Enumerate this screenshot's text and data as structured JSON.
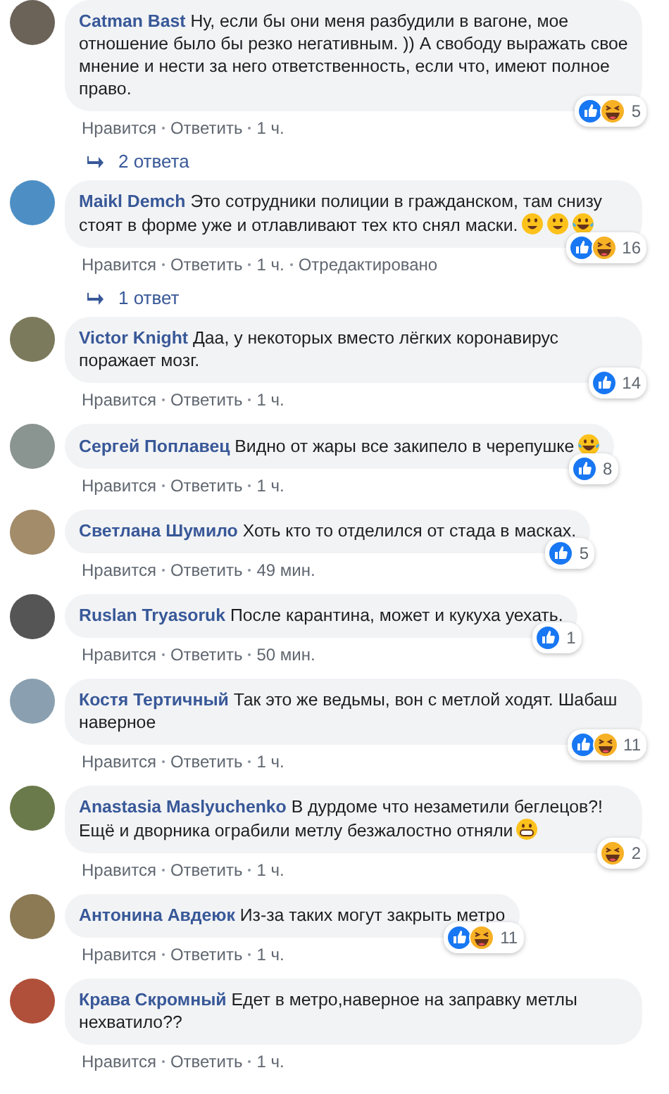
{
  "comments": [
    {
      "author": "Catman Bast",
      "text": "Ну, если бы они меня разбудили в вагоне, мое отношение было бы резко негативным. )) А свободу выражать свое мнение и нести за него ответственность, если что, имеют полное право.",
      "reactions": [
        {
          "kind": "like"
        },
        {
          "kind": "haha"
        }
      ],
      "reaction_count": "5",
      "actions": [
        "Нравится",
        "Ответить",
        "1 ч."
      ],
      "replies": "2 ответа"
    },
    {
      "author": "Maikl Demch",
      "text": "Это сотрудники полиции в гражданском, там снизу стоят в форме уже и отлавливают тех кто снял маски.",
      "emojis": [
        {
          "kind": "smile"
        },
        {
          "kind": "smile"
        },
        {
          "kind": "joy"
        }
      ],
      "reactions": [
        {
          "kind": "like"
        },
        {
          "kind": "haha"
        }
      ],
      "reaction_count": "16",
      "actions": [
        "Нравится",
        "Ответить",
        "1 ч.",
        "Отредактировано"
      ],
      "replies": "1 ответ"
    },
    {
      "author": "Victor Knight",
      "text": "Даа, у некоторых вместо лёгких коронавирус поражает мозг.",
      "reactions": [
        {
          "kind": "like"
        }
      ],
      "reaction_count": "14",
      "actions": [
        "Нравится",
        "Ответить",
        "1 ч."
      ]
    },
    {
      "author": "Сергей Поплавец",
      "text": "Видно от жары все закипело в черепушке",
      "emojis": [
        {
          "kind": "joy"
        }
      ],
      "reactions": [
        {
          "kind": "like"
        }
      ],
      "reaction_count": "8",
      "actions": [
        "Нравится",
        "Ответить",
        "1 ч."
      ]
    },
    {
      "author": "Светлана Шумило",
      "text": "Хоть кто то отделился от стада в масках.",
      "reactions": [
        {
          "kind": "like"
        }
      ],
      "reaction_count": "5",
      "actions": [
        "Нравится",
        "Ответить",
        "49 мин."
      ]
    },
    {
      "author": "Ruslan Tryasoruk",
      "text": "После карантина, может и кукуха уехать.",
      "reactions": [
        {
          "kind": "like"
        }
      ],
      "reaction_count": "1",
      "actions": [
        "Нравится",
        "Ответить",
        "50 мин."
      ]
    },
    {
      "author": "Костя Тертичный",
      "text": "Так это же ведьмы, вон с метлой ходят. Шабаш наверное",
      "reactions": [
        {
          "kind": "like"
        },
        {
          "kind": "haha"
        }
      ],
      "reaction_count": "11",
      "actions": [
        "Нравится",
        "Ответить",
        "1 ч."
      ]
    },
    {
      "author": "Anastasia Maslyuchenko",
      "text": "В дурдоме что незаметили беглецов?! Ещё и дворника ограбили метлу безжалостно отняли",
      "emojis": [
        {
          "kind": "grin"
        }
      ],
      "reactions": [
        {
          "kind": "haha"
        }
      ],
      "reaction_count": "2",
      "actions": [
        "Нравится",
        "Ответить",
        "1 ч."
      ]
    },
    {
      "author": "Антонина Авдеюк",
      "text": "Из-за таких могут закрыть метро",
      "reactions": [
        {
          "kind": "like"
        },
        {
          "kind": "haha"
        }
      ],
      "reaction_count": "11",
      "actions": [
        "Нравится",
        "Ответить",
        "1 ч."
      ]
    },
    {
      "author": "Крава Скромный",
      "text": "Едет в метро,наверное на заправку метлы нехватило??",
      "actions": [
        "Нравится",
        "Ответить",
        "1 ч."
      ]
    }
  ]
}
